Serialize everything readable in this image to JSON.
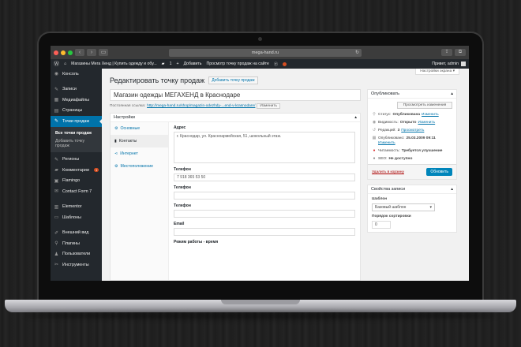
{
  "browser": {
    "url": "mega-hand.ru"
  },
  "admin_bar": {
    "site_name": "Магазины Мега Хенд | Купить одежду и обу...",
    "comments_count": "1",
    "add_label": "Добавить",
    "view_label": "Просмотр точку продаж на сайте",
    "greeting": "Привет, admin"
  },
  "sidebar": {
    "items_top": [
      {
        "label": "Консоль",
        "icon": "dashboard-icon"
      }
    ],
    "items_mid": [
      {
        "label": "Записи",
        "icon": "pin-icon"
      },
      {
        "label": "Медиафайлы",
        "icon": "media-icon"
      },
      {
        "label": "Страницы",
        "icon": "pages-icon"
      }
    ],
    "active": {
      "label": "Точки продаж",
      "icon": "pin-icon"
    },
    "submenu": [
      "Все точки продаж",
      "Добавить точку продаж"
    ],
    "items_after": [
      {
        "label": "Регионы",
        "icon": "pin-icon"
      },
      {
        "label": "Комментарии",
        "icon": "comment-icon",
        "badge": "1"
      },
      {
        "label": "Flamingo",
        "icon": "flamingo-icon"
      },
      {
        "label": "Contact Form 7",
        "icon": "mail-icon"
      }
    ],
    "items_group2": [
      {
        "label": "Elementor",
        "icon": "elementor-icon"
      },
      {
        "label": "Шаблоны",
        "icon": "folder-icon"
      }
    ],
    "items_group3": [
      {
        "label": "Внешний вид",
        "icon": "brush-icon"
      },
      {
        "label": "Плагины",
        "icon": "plugin-icon"
      },
      {
        "label": "Пользователи",
        "icon": "users-icon"
      },
      {
        "label": "Инструменты",
        "icon": "tools-icon"
      }
    ]
  },
  "main": {
    "screen_options": "Настройки экрана",
    "page_title": "Редактировать точку продаж",
    "add_new": "Добавить точку продаж",
    "post_title": "Магазин одежды МЕГАХЕНД в Краснодаре",
    "permalink_label": "Постоянная ссылка:",
    "permalink_url": "http://mega-hand.ru/shop/magazin-odezhdy-...end-v-krasnodare/",
    "permalink_btn": "Изменить",
    "settings_title": "Настройки",
    "tabs": [
      {
        "label": "Основные",
        "icon": "gear-icon"
      },
      {
        "label": "Контакты",
        "icon": "book-icon"
      },
      {
        "label": "Интернет",
        "icon": "share-icon"
      },
      {
        "label": "Местоположение",
        "icon": "location-icon"
      }
    ],
    "fields": {
      "address_label": "Адрес",
      "address_value": "г. Краснодар, ул. Красноармейская, 51, шокольный этаж.",
      "phone1_label": "Телефон",
      "phone1_value": "7 918 365 53 50",
      "phone2_label": "Телефон",
      "phone3_label": "Телефон",
      "email_label": "Email",
      "hours_label": "Режим работы - время"
    }
  },
  "publish": {
    "title": "Опубликовать",
    "preview_btn": "Просмотреть изменения",
    "status_label": "Статус:",
    "status_value": "Опубликована",
    "visibility_label": "Видимость:",
    "visibility_value": "Открыто",
    "revisions_label": "Редакций:",
    "revisions_value": "3",
    "revisions_link": "Просмотреть",
    "published_label": "Опубликовано:",
    "published_value": "25.03.2009 09:11",
    "readability_label": "Читаемость:",
    "readability_value": "Требуется улучшение",
    "seo_label": "SEO:",
    "seo_value": "Не доступно",
    "edit_link": "Изменить",
    "trash": "Удалить в корзину",
    "update_btn": "Обновить"
  },
  "attributes": {
    "title": "Свойства записи",
    "template_label": "Шаблон",
    "template_value": "Базовый шаблон",
    "order_label": "Порядок сортировки",
    "order_value": "0"
  }
}
